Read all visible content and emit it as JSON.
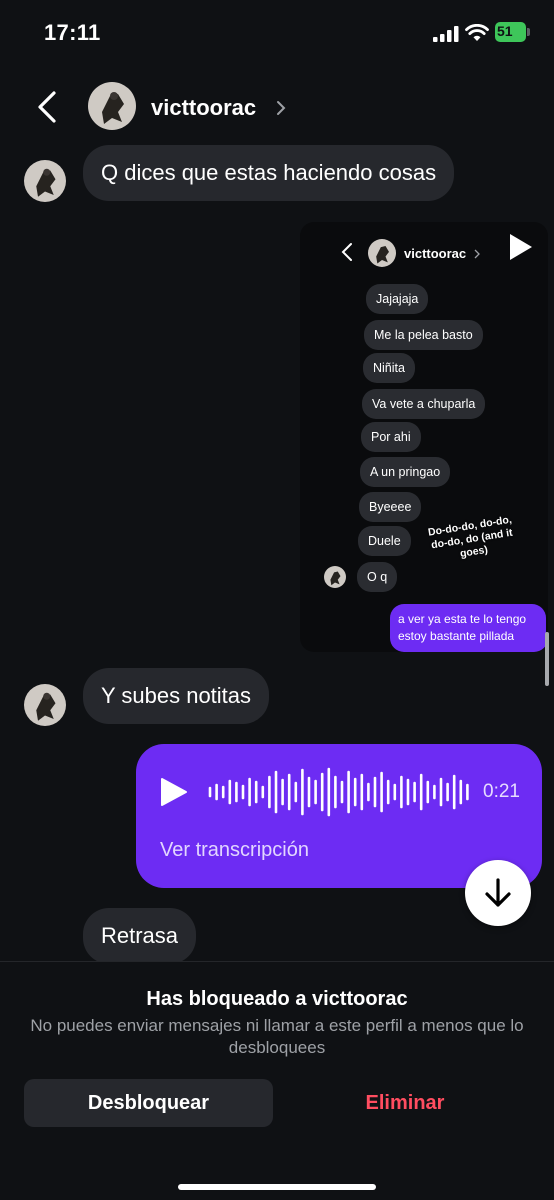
{
  "status_bar": {
    "time": "17:11",
    "battery": "51"
  },
  "header": {
    "username": "victtoorac"
  },
  "messages": {
    "incoming_1": "Q dices que estas haciendo cosas",
    "incoming_2": "Y subes notitas",
    "incoming_3": "Retrasa"
  },
  "shared_screenshot": {
    "username": "victtoorac",
    "bubbles": [
      "Jajajaja",
      "Me la pelea basto",
      "Niñita",
      "Va vete a chuparla",
      "Por ahi",
      "A un pringao",
      "Byeeee",
      "Duele",
      "O q"
    ],
    "sticker_text": "Do-do-do, do-do, do-do, do (and it goes)",
    "outgoing_text": "a ver ya esta te lo tengo estoy bastante pillada"
  },
  "voice_message": {
    "duration": "0:21",
    "transcript_label": "Ver transcripción"
  },
  "block_panel": {
    "title": "Has bloqueado a victtoorac",
    "description": "No puedes enviar mensajes ni llamar a este perfil a menos que lo desbloquees",
    "unblock_label": "Desbloquear",
    "delete_label": "Eliminar"
  },
  "colors": {
    "background": "#0f1114",
    "incoming_bubble": "#26282d",
    "outgoing_bubble": "#6d2cf3",
    "delete_red": "#ff4d60",
    "battery_green": "#3ec65a"
  },
  "icons": [
    "back-icon",
    "chevron-right-icon",
    "play-icon",
    "arrow-down-icon",
    "signal-icon",
    "wifi-icon",
    "battery-icon"
  ]
}
